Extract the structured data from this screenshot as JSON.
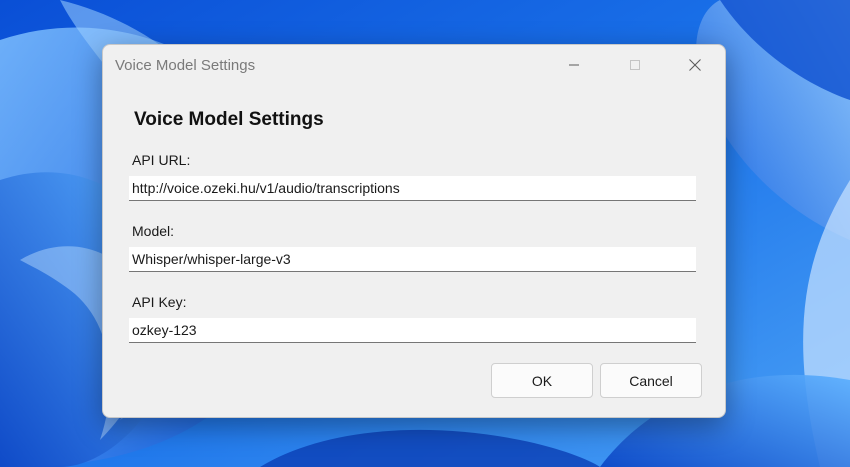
{
  "window": {
    "title": "Voice Model Settings"
  },
  "form": {
    "heading": "Voice Model Settings",
    "api_url": {
      "label": "API URL:",
      "value": "http://voice.ozeki.hu/v1/audio/transcriptions"
    },
    "model": {
      "label": "Model:",
      "value": "Whisper/whisper-large-v3"
    },
    "api_key": {
      "label": "API Key:",
      "value": "ozkey-123"
    }
  },
  "buttons": {
    "ok_label": "OK",
    "cancel_label": "Cancel"
  },
  "icons": {
    "minimize": "minimize-icon",
    "maximize": "maximize-icon",
    "close": "close-icon"
  },
  "colors": {
    "wallpaper_accent": "#1e6ee6",
    "dialog_bg": "#f0f0f0"
  }
}
